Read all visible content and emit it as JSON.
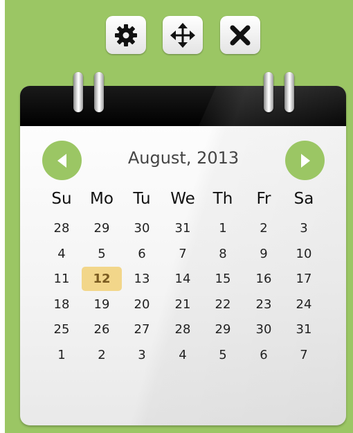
{
  "toolbar": {
    "buttons": [
      {
        "name": "settings",
        "icon": "gear-icon"
      },
      {
        "name": "move",
        "icon": "move-arrows-icon"
      },
      {
        "name": "close",
        "icon": "close-icon"
      }
    ]
  },
  "calendar": {
    "month_title": "August, 2013",
    "prev_icon": "chevron-left-icon",
    "next_icon": "chevron-right-icon",
    "weekdays": [
      "Su",
      "Mo",
      "Tu",
      "We",
      "Th",
      "Fr",
      "Sa"
    ],
    "selected_day": "12",
    "weeks": [
      [
        "28",
        "29",
        "30",
        "31",
        "1",
        "2",
        "3"
      ],
      [
        "4",
        "5",
        "6",
        "7",
        "8",
        "9",
        "10"
      ],
      [
        "11",
        "12",
        "13",
        "14",
        "15",
        "16",
        "17"
      ],
      [
        "18",
        "19",
        "20",
        "21",
        "22",
        "23",
        "24"
      ],
      [
        "25",
        "26",
        "27",
        "28",
        "29",
        "30",
        "31"
      ],
      [
        "1",
        "2",
        "3",
        "4",
        "5",
        "6",
        "7"
      ]
    ]
  },
  "colors": {
    "background": "#9bc664",
    "accent": "#9bc664",
    "today_highlight": "#f2d68a",
    "binding": "#000000"
  }
}
